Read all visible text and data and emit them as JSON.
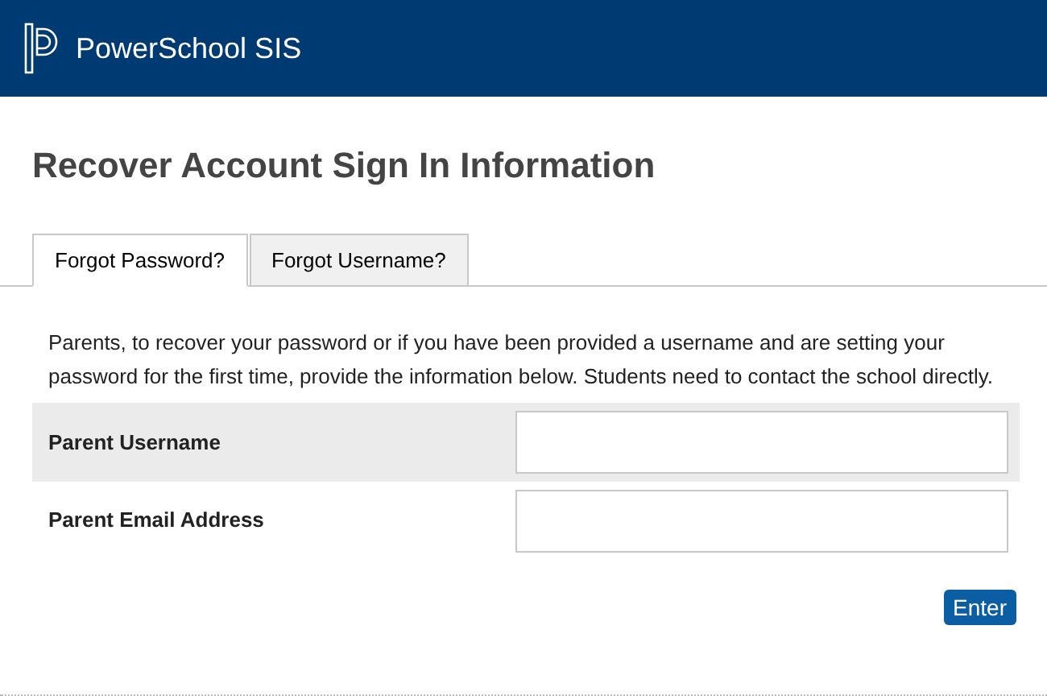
{
  "header": {
    "brand": "PowerSchool SIS"
  },
  "page_title": "Recover Account Sign In Information",
  "tabs": [
    {
      "label": "Forgot Password?",
      "selected": true
    },
    {
      "label": "Forgot Username?",
      "selected": false
    }
  ],
  "instructions": "Parents, to recover your password or if you have been provided a username and are setting your password for the first time, provide the information below. Students need to contact the school directly.",
  "fields": [
    {
      "label": "Parent Username"
    },
    {
      "label": "Parent Email Address"
    }
  ],
  "submit_button": "Enter"
}
